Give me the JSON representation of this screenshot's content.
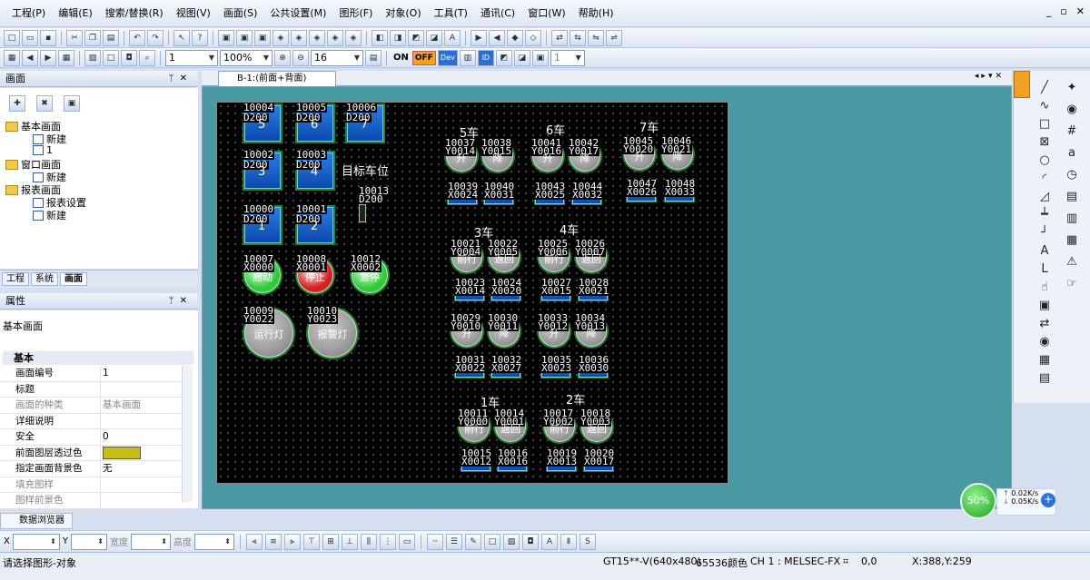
{
  "menu": [
    "工程(P)",
    "编辑(E)",
    "搜索/替换(R)",
    "视图(V)",
    "画面(S)",
    "公共设置(M)",
    "图形(F)",
    "对象(O)",
    "工具(T)",
    "通讯(C)",
    "窗口(W)",
    "帮助(H)"
  ],
  "toolbar2": {
    "combo1": "1",
    "zoom": "100%",
    "font_size": "16",
    "on_label": "ON",
    "off_label": "OFF",
    "dev_label": "Dev",
    "id_label": "ID",
    "combo2": "1"
  },
  "screen_panel": {
    "title": "画面",
    "tree": [
      {
        "label": "基本画面"
      },
      {
        "label": "新建"
      },
      {
        "label": "1"
      },
      {
        "label": "窗口画面"
      },
      {
        "label": "新建"
      },
      {
        "label": "报表画面"
      },
      {
        "label": "报表设置"
      },
      {
        "label": "新建"
      }
    ],
    "tabs": [
      "工程",
      "系统",
      "画面"
    ]
  },
  "properties": {
    "title": "属性",
    "object": "基本画面",
    "section": "基本",
    "rows": [
      {
        "key": "画面编号",
        "value": "1"
      },
      {
        "key": "标题",
        "value": ""
      },
      {
        "key": "画面的种类",
        "value": "基本画面"
      },
      {
        "key": "详细说明",
        "value": ""
      },
      {
        "key": "安全",
        "value": "0"
      },
      {
        "key": "前面图层透过色",
        "value": ""
      },
      {
        "key": "指定画面背景色",
        "value": "无"
      },
      {
        "key": "填充图样",
        "value": ""
      },
      {
        "key": "图样前景色",
        "value": ""
      }
    ],
    "swatch_color": "#c8bd12"
  },
  "document_tab": "B-1:(前面+背面)",
  "canvas": {
    "target_label": "目标车位",
    "target_addr": "10013",
    "target_d": "D200",
    "floor_buttons": [
      {
        "addr": "10004",
        "d": "D200",
        "num": "5"
      },
      {
        "addr": "10005",
        "d": "D200",
        "num": "6"
      },
      {
        "addr": "10006",
        "d": "D200",
        "num": "7"
      },
      {
        "addr": "10002",
        "d": "D200",
        "num": "3"
      },
      {
        "addr": "10003",
        "d": "D200",
        "num": "4"
      },
      {
        "addr": "10000",
        "d": "D200",
        "num": "1"
      },
      {
        "addr": "10001",
        "d": "D200",
        "num": "2"
      }
    ],
    "control_lamps": [
      {
        "addr": "10007",
        "x": "X0000",
        "label": "启动"
      },
      {
        "addr": "10008",
        "x": "X0001",
        "label": "停止"
      },
      {
        "addr": "10012",
        "x": "X0002",
        "label": "急停"
      }
    ],
    "indicator_lamps": [
      {
        "addr": "10009",
        "y": "Y0022",
        "label": "运行灯"
      },
      {
        "addr": "10010",
        "y": "Y0023",
        "label": "报警灯"
      }
    ],
    "groups": [
      "5车",
      "6车",
      "7车",
      "3车",
      "4车",
      "1车",
      "2车"
    ],
    "small_labels": [
      "10037",
      "10038",
      "10041",
      "10042",
      "10045",
      "10046",
      "10039",
      "10040",
      "10043",
      "10044",
      "10047",
      "10048",
      "10021",
      "10022",
      "10025",
      "10026",
      "10023",
      "10024",
      "10027",
      "10028",
      "10029",
      "10030",
      "10033",
      "10034",
      "10031",
      "10032",
      "10035",
      "10036",
      "10011",
      "10014",
      "10017",
      "10018",
      "10015",
      "10016",
      "10019",
      "10020"
    ],
    "y_labels": [
      "Y0014",
      "Y0015",
      "Y0016",
      "Y0017",
      "Y0020",
      "Y0021",
      "Y0004",
      "Y0005",
      "Y0006",
      "Y0007",
      "Y0010",
      "Y0011",
      "Y0012",
      "Y0013",
      "Y0000",
      "Y0001",
      "Y0002",
      "Y0003"
    ],
    "x_labels": [
      "X0024",
      "X0031",
      "X0025",
      "X0032",
      "X0026",
      "X0033",
      "X0014",
      "X0020",
      "X0015",
      "X0021",
      "X0022",
      "X0027",
      "X0023",
      "X0030",
      "X0012",
      "X0016",
      "X0013",
      "X0017"
    ],
    "lamp_words": [
      "升",
      "降",
      "升",
      "降",
      "升",
      "降",
      "前行",
      "返回",
      "前行",
      "返回",
      "升",
      "降",
      "升",
      "降",
      "前行",
      "返回",
      "前行",
      "返回"
    ]
  },
  "network": {
    "percent": "50%",
    "up": "0.02K/s",
    "down": "0.05K/s"
  },
  "data_browser": "数据浏览器",
  "bottom_toolbar": {
    "x_label": "X",
    "y_label": "Y",
    "width_label": "宽度",
    "height_label": "高度"
  },
  "status": {
    "hint": "请选择图形-对象",
    "model": "GT15**-V(640x480)",
    "colors": "65536颜色",
    "channel": "CH 1 : MELSEC-FX",
    "coord0": "0,0",
    "cursor": "X:388,Y:259"
  },
  "colors": {
    "lamp_green": "#2fcc3a",
    "lamp_red": "#d61f1f",
    "button_blue": "#1560d0",
    "canvas_bg": "#000000",
    "doc_bg": "#4a9aa4"
  }
}
